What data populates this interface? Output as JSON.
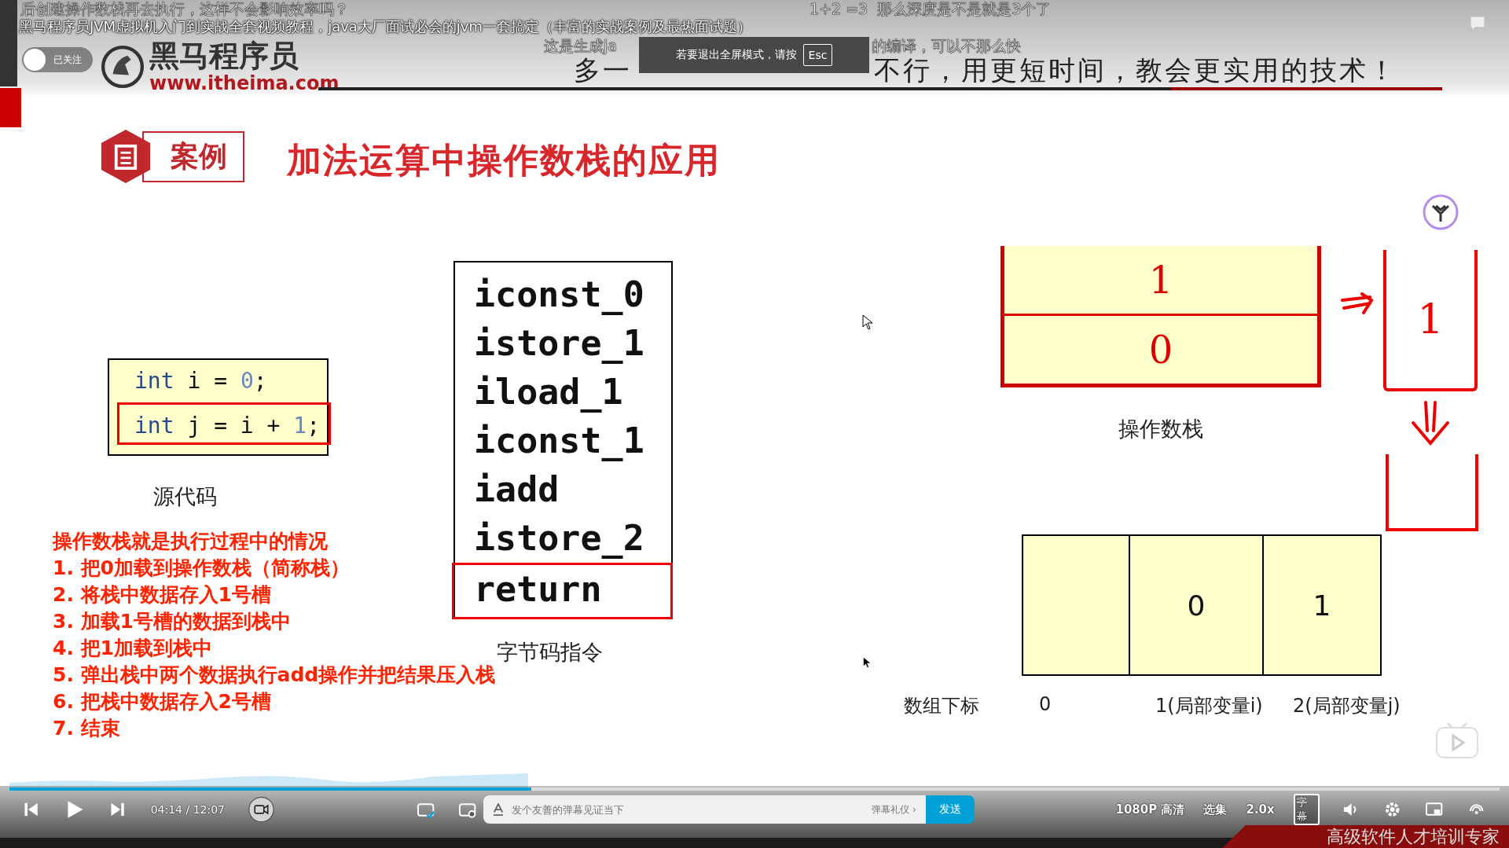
{
  "video_title": "黑马程序员JVM虚拟机入门到实战全套视频教程，java大厂面试必会的jvm一套搞定（丰富的实战案例及最热面试题）",
  "uploader": {
    "follow_label": "已关注"
  },
  "fullscreen_notice": {
    "text": "若要退出全屏模式，请按",
    "key": "Esc"
  },
  "danmaku": [
    {
      "parts": [
        "后创建操作数栈再去执行，这样不会影响效率吗？"
      ]
    },
    {
      "parts": [
        "1+2 =3  那么深度是不是就是3个了"
      ]
    },
    {
      "parts": [
        "这是生成ja",
        "的编译，可以不那么快"
      ]
    }
  ],
  "slide": {
    "brand": {
      "name": "黑马程序员",
      "url": "www.itheima.com"
    },
    "slogan_parts": [
      "多一",
      "不行，用更短时间，教会更实用的技术！"
    ],
    "tag": "案例",
    "title": "加法运算中操作数栈的应用",
    "source_code": [
      {
        "highlighted": false,
        "tokens": [
          {
            "kind": "keyword",
            "text": "int"
          },
          {
            "kind": "plain",
            "text": " i = "
          },
          {
            "kind": "number",
            "text": "0"
          },
          {
            "kind": "plain",
            "text": ";"
          }
        ]
      },
      {
        "highlighted": true,
        "tokens": [
          {
            "kind": "keyword",
            "text": "int"
          },
          {
            "kind": "plain",
            "text": " j = i + "
          },
          {
            "kind": "number",
            "text": "1"
          },
          {
            "kind": "plain",
            "text": ";"
          }
        ]
      }
    ],
    "source_caption": "源代码",
    "notes": [
      "操作数栈就是执行过程中的情况",
      "1. 把0加载到操作数栈（简称栈）",
      "2. 将栈中数据存入1号槽",
      "3. 加载1号槽的数据到栈中",
      "4. 把1加载到栈中",
      "5. 弹出栈中两个数据执行add操作并把结果压入栈",
      "6. 把栈中数据存入2号槽",
      "7. 结束"
    ],
    "bytecode": [
      {
        "text": "iconst_0",
        "highlighted": false
      },
      {
        "text": "istore_1",
        "highlighted": false
      },
      {
        "text": "iload_1",
        "highlighted": false
      },
      {
        "text": "iconst_1",
        "highlighted": false
      },
      {
        "text": "iadd",
        "highlighted": false
      },
      {
        "text": "istore_2",
        "highlighted": false
      },
      {
        "text": "return",
        "highlighted": true
      }
    ],
    "bytecode_caption": "字节码指令",
    "operand_stack": {
      "entries": [
        "1",
        "0"
      ],
      "caption": "操作数栈"
    },
    "sketch_stack": [
      "1"
    ],
    "local_variables": {
      "cells": [
        {},
        {
          "value": "0"
        },
        {
          "value": "1"
        }
      ],
      "index_heading": "数组下标",
      "indices": [
        "0",
        "1(局部变量i)",
        "2(局部变量j)"
      ]
    },
    "footer_tagline": "高级软件人才培训专家"
  },
  "player": {
    "progress": {
      "level": 0.35
    },
    "time": "04:14 / 12:07",
    "danmaku_input": {
      "placeholder": "发个友善的弹幕见证当下",
      "etiquette": "弹幕礼仪 ›"
    },
    "send": "发送",
    "quality": "1080P 高清",
    "episodes": "选集",
    "speed": "2.0x",
    "subtitle": "字幕"
  }
}
